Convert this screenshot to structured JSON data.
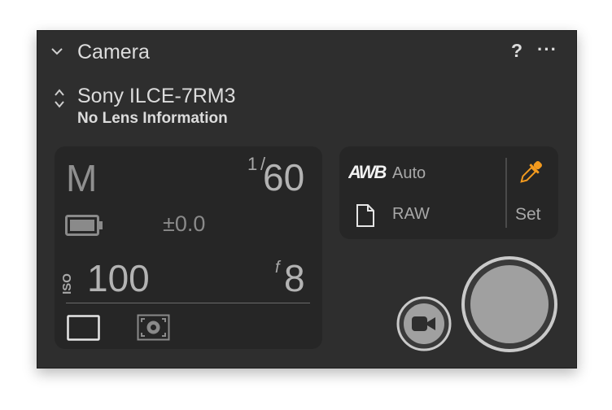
{
  "header": {
    "title": "Camera",
    "help_label": "?",
    "more_label": "···"
  },
  "camera": {
    "model": "Sony ILCE-7RM3",
    "lens": "No Lens Information"
  },
  "exposure": {
    "mode": "M",
    "shutter_numerator": "1",
    "shutter_slash": "/",
    "shutter_denominator": "60",
    "exposure_comp": "±0.0",
    "iso_label": "ISO",
    "iso_value": "100",
    "aperture_label": "f",
    "aperture_value": "8",
    "battery_icon": "battery-icon",
    "frame_icon": "crop-frame-icon",
    "metering_icon": "metering-mode-icon"
  },
  "white_balance": {
    "awb_label": "AWB",
    "value": "Auto",
    "format": "RAW",
    "set_label": "Set",
    "accent": "#f39a1e"
  },
  "controls": {
    "video_icon": "video-camera-icon",
    "shutter_icon": "shutter-button"
  }
}
